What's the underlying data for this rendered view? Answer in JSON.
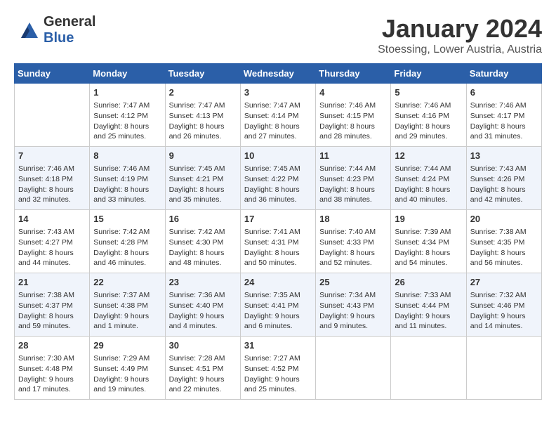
{
  "header": {
    "logo_general": "General",
    "logo_blue": "Blue",
    "title": "January 2024",
    "subtitle": "Stoessing, Lower Austria, Austria"
  },
  "calendar": {
    "days_of_week": [
      "Sunday",
      "Monday",
      "Tuesday",
      "Wednesday",
      "Thursday",
      "Friday",
      "Saturday"
    ],
    "weeks": [
      [
        {
          "day": "",
          "info": ""
        },
        {
          "day": "1",
          "info": "Sunrise: 7:47 AM\nSunset: 4:12 PM\nDaylight: 8 hours\nand 25 minutes."
        },
        {
          "day": "2",
          "info": "Sunrise: 7:47 AM\nSunset: 4:13 PM\nDaylight: 8 hours\nand 26 minutes."
        },
        {
          "day": "3",
          "info": "Sunrise: 7:47 AM\nSunset: 4:14 PM\nDaylight: 8 hours\nand 27 minutes."
        },
        {
          "day": "4",
          "info": "Sunrise: 7:46 AM\nSunset: 4:15 PM\nDaylight: 8 hours\nand 28 minutes."
        },
        {
          "day": "5",
          "info": "Sunrise: 7:46 AM\nSunset: 4:16 PM\nDaylight: 8 hours\nand 29 minutes."
        },
        {
          "day": "6",
          "info": "Sunrise: 7:46 AM\nSunset: 4:17 PM\nDaylight: 8 hours\nand 31 minutes."
        }
      ],
      [
        {
          "day": "7",
          "info": "Sunrise: 7:46 AM\nSunset: 4:18 PM\nDaylight: 8 hours\nand 32 minutes."
        },
        {
          "day": "8",
          "info": "Sunrise: 7:46 AM\nSunset: 4:19 PM\nDaylight: 8 hours\nand 33 minutes."
        },
        {
          "day": "9",
          "info": "Sunrise: 7:45 AM\nSunset: 4:21 PM\nDaylight: 8 hours\nand 35 minutes."
        },
        {
          "day": "10",
          "info": "Sunrise: 7:45 AM\nSunset: 4:22 PM\nDaylight: 8 hours\nand 36 minutes."
        },
        {
          "day": "11",
          "info": "Sunrise: 7:44 AM\nSunset: 4:23 PM\nDaylight: 8 hours\nand 38 minutes."
        },
        {
          "day": "12",
          "info": "Sunrise: 7:44 AM\nSunset: 4:24 PM\nDaylight: 8 hours\nand 40 minutes."
        },
        {
          "day": "13",
          "info": "Sunrise: 7:43 AM\nSunset: 4:26 PM\nDaylight: 8 hours\nand 42 minutes."
        }
      ],
      [
        {
          "day": "14",
          "info": "Sunrise: 7:43 AM\nSunset: 4:27 PM\nDaylight: 8 hours\nand 44 minutes."
        },
        {
          "day": "15",
          "info": "Sunrise: 7:42 AM\nSunset: 4:28 PM\nDaylight: 8 hours\nand 46 minutes."
        },
        {
          "day": "16",
          "info": "Sunrise: 7:42 AM\nSunset: 4:30 PM\nDaylight: 8 hours\nand 48 minutes."
        },
        {
          "day": "17",
          "info": "Sunrise: 7:41 AM\nSunset: 4:31 PM\nDaylight: 8 hours\nand 50 minutes."
        },
        {
          "day": "18",
          "info": "Sunrise: 7:40 AM\nSunset: 4:33 PM\nDaylight: 8 hours\nand 52 minutes."
        },
        {
          "day": "19",
          "info": "Sunrise: 7:39 AM\nSunset: 4:34 PM\nDaylight: 8 hours\nand 54 minutes."
        },
        {
          "day": "20",
          "info": "Sunrise: 7:38 AM\nSunset: 4:35 PM\nDaylight: 8 hours\nand 56 minutes."
        }
      ],
      [
        {
          "day": "21",
          "info": "Sunrise: 7:38 AM\nSunset: 4:37 PM\nDaylight: 8 hours\nand 59 minutes."
        },
        {
          "day": "22",
          "info": "Sunrise: 7:37 AM\nSunset: 4:38 PM\nDaylight: 9 hours\nand 1 minute."
        },
        {
          "day": "23",
          "info": "Sunrise: 7:36 AM\nSunset: 4:40 PM\nDaylight: 9 hours\nand 4 minutes."
        },
        {
          "day": "24",
          "info": "Sunrise: 7:35 AM\nSunset: 4:41 PM\nDaylight: 9 hours\nand 6 minutes."
        },
        {
          "day": "25",
          "info": "Sunrise: 7:34 AM\nSunset: 4:43 PM\nDaylight: 9 hours\nand 9 minutes."
        },
        {
          "day": "26",
          "info": "Sunrise: 7:33 AM\nSunset: 4:44 PM\nDaylight: 9 hours\nand 11 minutes."
        },
        {
          "day": "27",
          "info": "Sunrise: 7:32 AM\nSunset: 4:46 PM\nDaylight: 9 hours\nand 14 minutes."
        }
      ],
      [
        {
          "day": "28",
          "info": "Sunrise: 7:30 AM\nSunset: 4:48 PM\nDaylight: 9 hours\nand 17 minutes."
        },
        {
          "day": "29",
          "info": "Sunrise: 7:29 AM\nSunset: 4:49 PM\nDaylight: 9 hours\nand 19 minutes."
        },
        {
          "day": "30",
          "info": "Sunrise: 7:28 AM\nSunset: 4:51 PM\nDaylight: 9 hours\nand 22 minutes."
        },
        {
          "day": "31",
          "info": "Sunrise: 7:27 AM\nSunset: 4:52 PM\nDaylight: 9 hours\nand 25 minutes."
        },
        {
          "day": "",
          "info": ""
        },
        {
          "day": "",
          "info": ""
        },
        {
          "day": "",
          "info": ""
        }
      ]
    ]
  }
}
